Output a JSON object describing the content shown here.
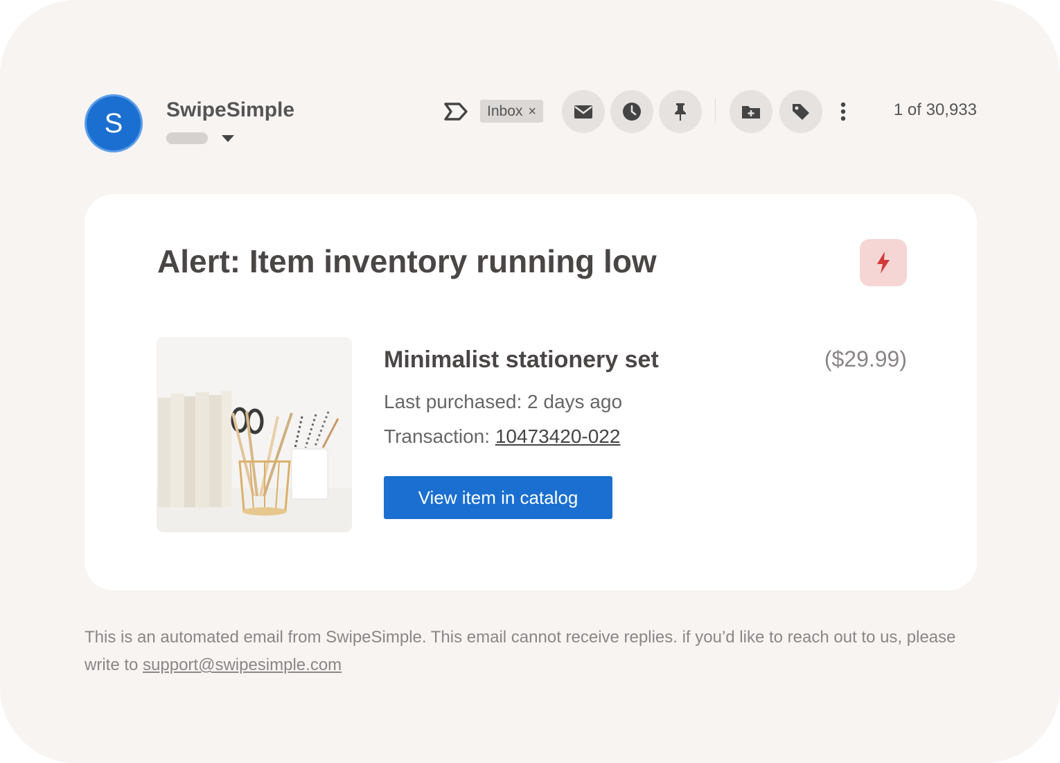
{
  "sender": {
    "initial": "S",
    "name": "SwipeSimple"
  },
  "toolbar": {
    "label_chip": "Inbox",
    "chip_close": "×",
    "icons": [
      "label-icon",
      "mail-icon",
      "clock-icon",
      "pin-icon",
      "folder-add-icon",
      "tag-icon",
      "more-vertical-icon"
    ],
    "counter": "1 of 30,933"
  },
  "card": {
    "title": "Alert: Item inventory running low",
    "badge_icon": "lightning-bolt-icon",
    "item": {
      "name": "Minimalist stationery set",
      "price": "($29.99)",
      "last_purchased": "Last purchased: 2 days ago",
      "transaction_label": "Transaction: ",
      "transaction_id": "10473420-022",
      "button_label": "View item in catalog"
    }
  },
  "footer": {
    "text": "This is an automated email from SwipeSimple. This email cannot receive replies. if you’d like to reach out to us, please write to ",
    "support_email": "support@swipesimple.com"
  },
  "colors": {
    "accent": "#1a6fd0",
    "badge_bg": "#f6d5d5",
    "badge_icon": "#d23a3a",
    "background": "#f7f4f2"
  }
}
